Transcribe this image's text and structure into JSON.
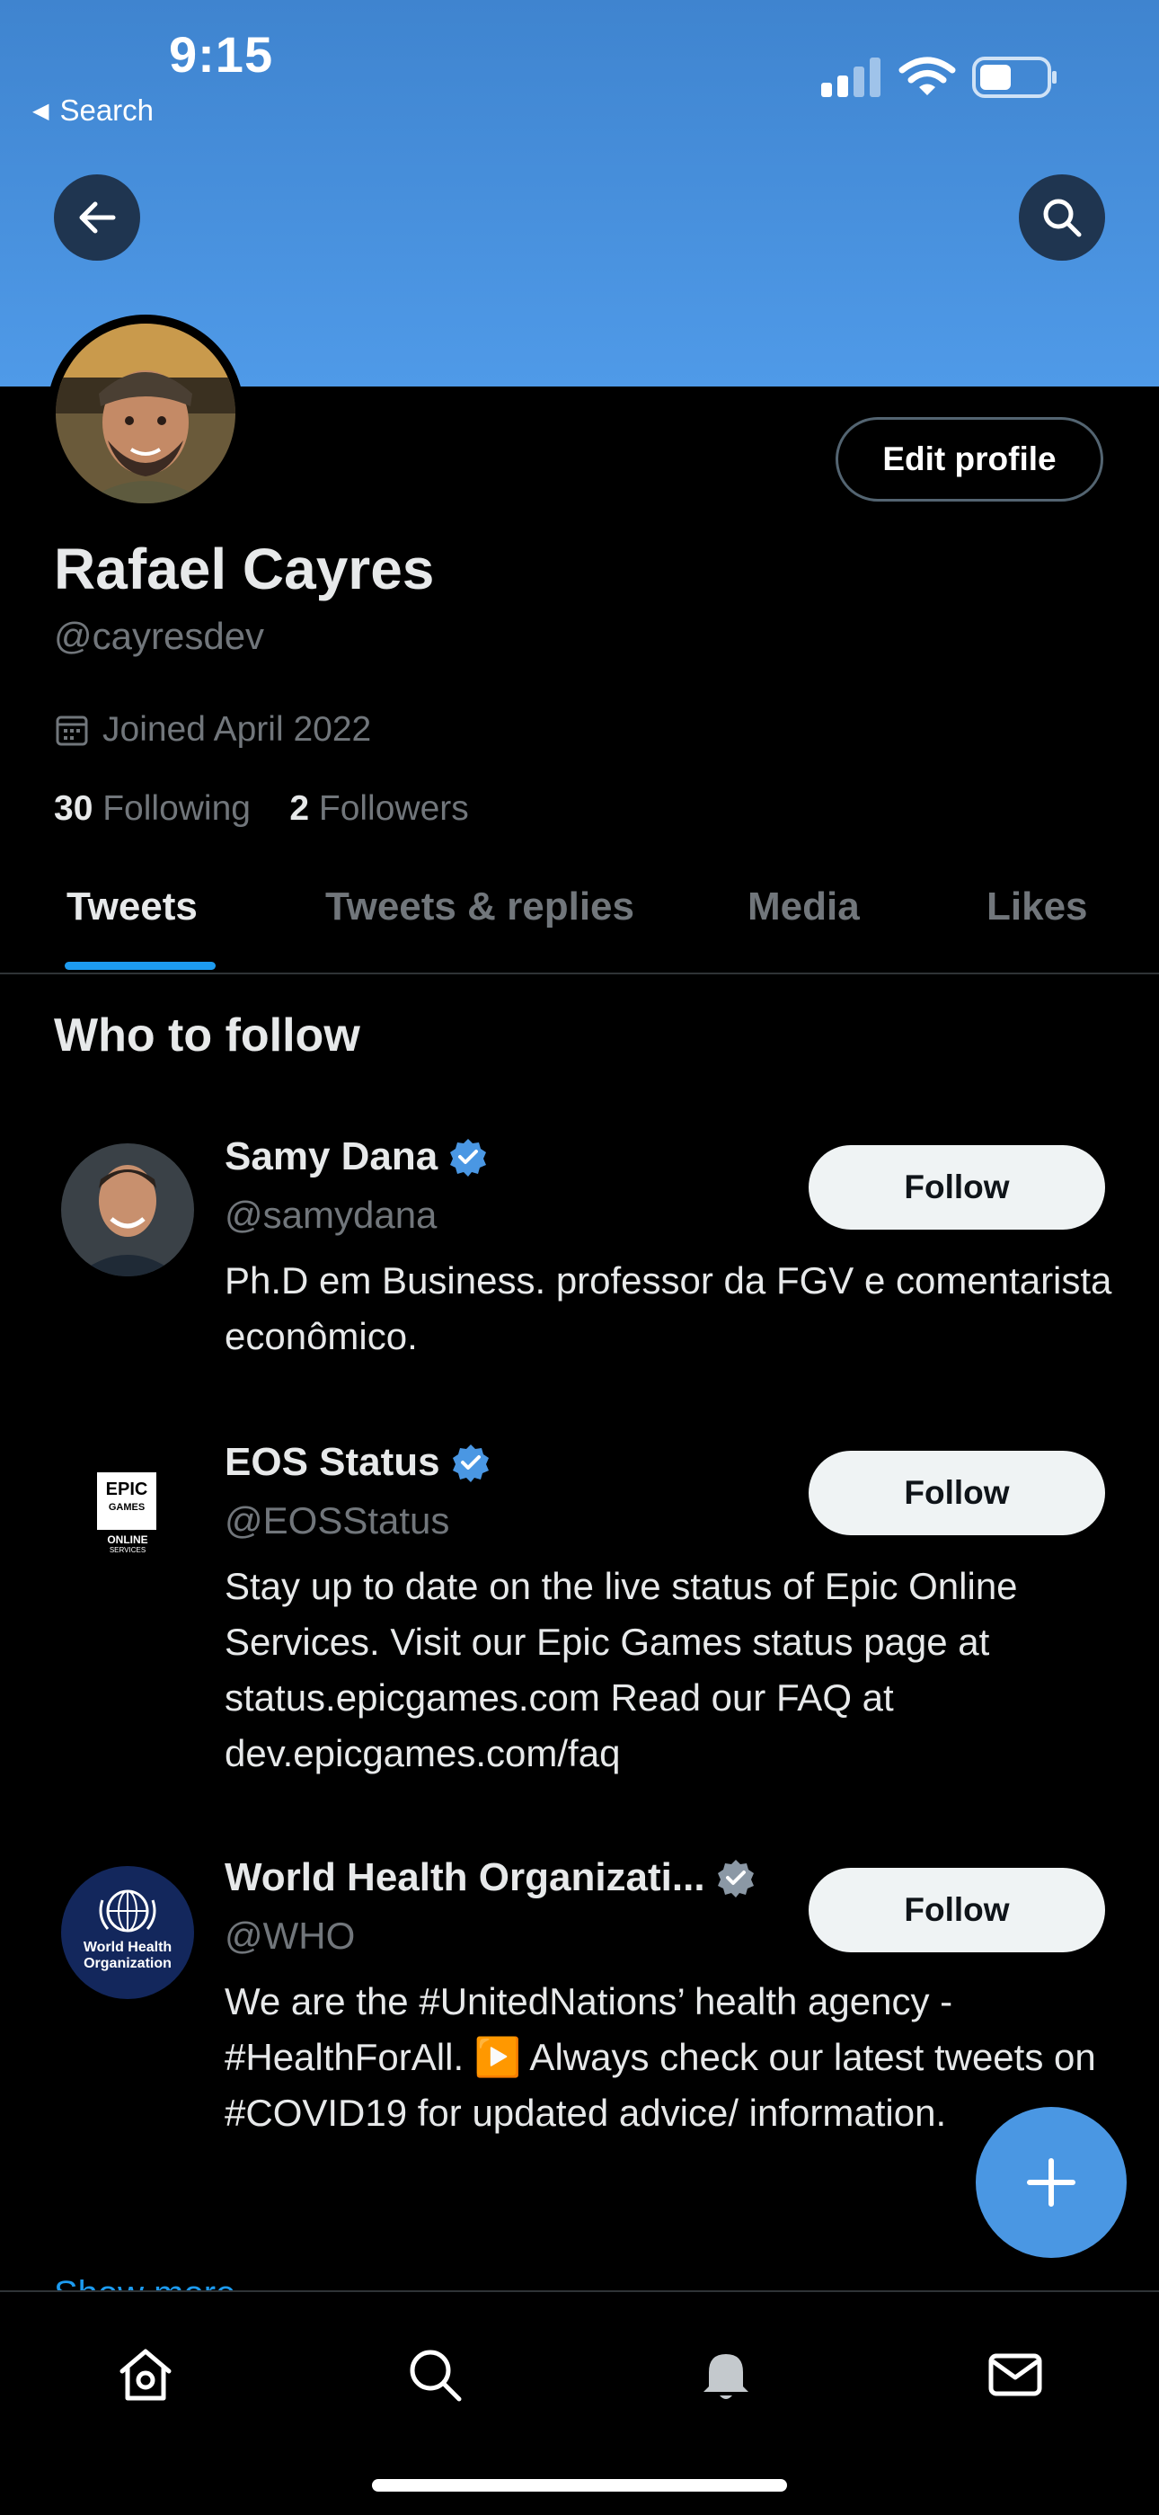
{
  "status_bar": {
    "time": "9:15",
    "back_app": "Search",
    "back_glyph": "◀"
  },
  "header": {
    "back_icon": "arrow-left-icon",
    "search_icon": "search-icon",
    "banner_color": "#4f9ae8"
  },
  "profile": {
    "name": "Rafael Cayres",
    "handle": "@cayresdev",
    "edit_label": "Edit profile",
    "joined": "Joined April 2022",
    "following_count": "30",
    "following_label": "Following",
    "followers_count": "2",
    "followers_label": "Followers"
  },
  "tabs": [
    {
      "label": "Tweets"
    },
    {
      "label": "Tweets & replies"
    },
    {
      "label": "Media"
    },
    {
      "label": "Likes"
    }
  ],
  "who_to_follow": {
    "title": "Who to follow",
    "items": [
      {
        "name": "Samy Dana",
        "handle": "@samydana",
        "bio": "Ph.D em Business. professor da FGV e comentarista econômico.",
        "follow_label": "Follow",
        "verified": true
      },
      {
        "name": "EOS Status",
        "handle": "@EOSStatus",
        "bio": "Stay up to date on the live status of Epic Online Services. Visit our Epic Games status page at status.epicgames.com Read our FAQ at dev.epicgames.com/faq",
        "follow_label": "Follow",
        "verified": true
      },
      {
        "name": "World Health Organizati...",
        "handle": "@WHO",
        "bio": "We are the #UnitedNations’ health agency - #HealthForAll. ▶️ Always check our latest tweets on #COVID19 for updated advice/ information.",
        "follow_label": "Follow",
        "verified": true
      }
    ],
    "show_more": "Show more"
  },
  "logos": {
    "epic": {
      "line1": "EPIC",
      "line2": "GAMES",
      "line3": "ONLINE",
      "line4": "SERVICES"
    },
    "who": {
      "line1": "World Health",
      "line2": "Organization"
    }
  },
  "colors": {
    "accent": "#1d9bf0",
    "background": "#000000",
    "muted": "#71767b"
  },
  "bottom_nav": [
    "home-icon",
    "search-icon",
    "notifications-bell-icon",
    "messages-envelope-icon"
  ]
}
